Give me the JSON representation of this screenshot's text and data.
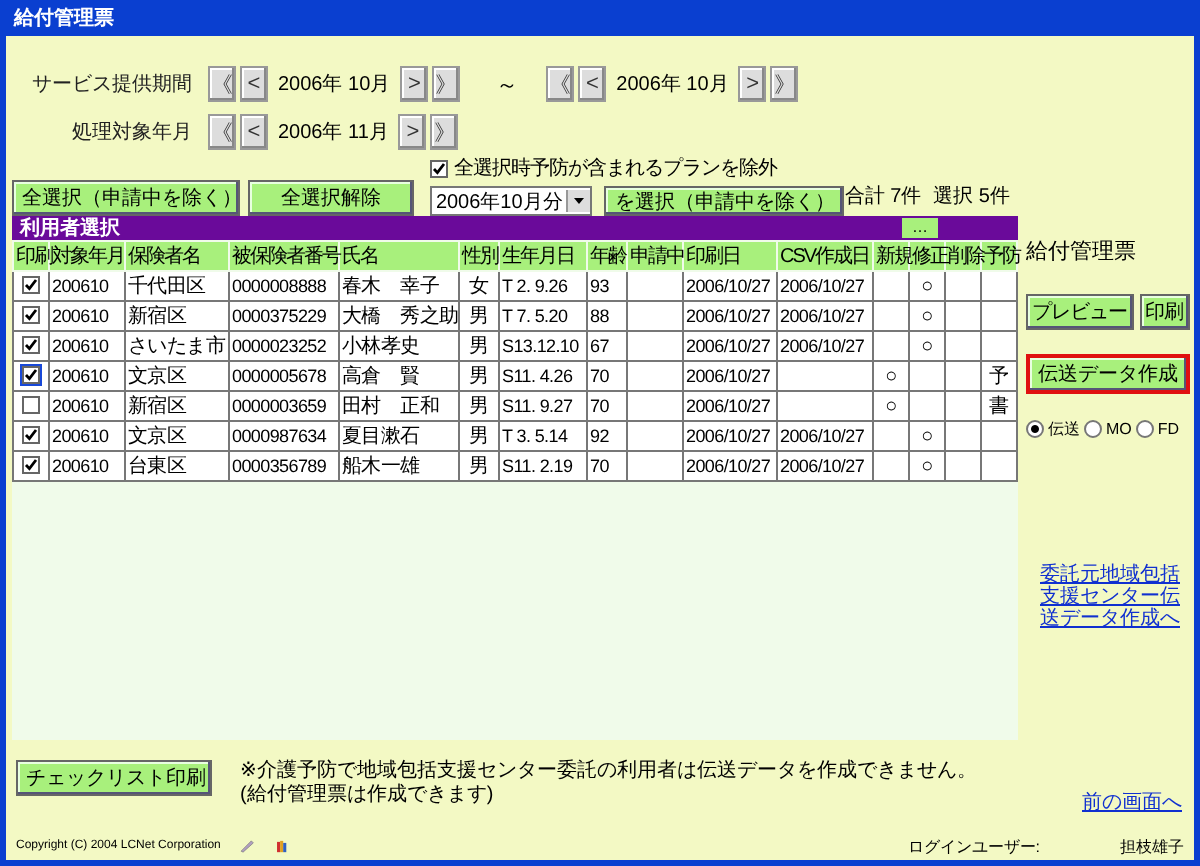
{
  "window": {
    "title": "給付管理票"
  },
  "service_period": {
    "label": "サービス提供期間",
    "from": {
      "prev_buttons": [
        "《",
        "<"
      ],
      "value": "2006年 10月",
      "next_buttons": [
        ">",
        "》"
      ]
    },
    "separator": "～",
    "to": {
      "prev_buttons": [
        "《",
        "<"
      ],
      "value": "2006年 10月",
      "next_buttons": [
        ">",
        "》"
      ]
    }
  },
  "processing_month": {
    "label": "処理対象年月",
    "prev_buttons": [
      "《",
      "<"
    ],
    "value": "2006年 11月",
    "next_buttons": [
      ">",
      "》"
    ]
  },
  "select_all_button": "全選択（申請中を除く）",
  "deselect_all_button": "全選択解除",
  "exclude_prevention": {
    "label": "全選択時予防が含まれるプランを除外",
    "checked": true
  },
  "month_select": {
    "value": "2006年10月分",
    "button": "を選択（申請中を除く）"
  },
  "totals": [
    "合計 7件",
    "選択 5件"
  ],
  "user_list": {
    "title": "利用者選択",
    "more_button": "…"
  },
  "table": {
    "columns": [
      "印刷",
      "対象年月",
      "保険者名",
      "被保険者番号",
      "氏名",
      "性別",
      "生年月日",
      "年齢",
      "申請中",
      "印刷日",
      "CSV作成日",
      "新規",
      "修正",
      "削除",
      "予防"
    ],
    "rows": [
      {
        "print": true,
        "focused": false,
        "cells": [
          "",
          "200610",
          "千代田区",
          "0000008888",
          "春木　幸子",
          "女",
          "T 2. 9.26",
          "93",
          "",
          "2006/10/27",
          "2006/10/27",
          "",
          "○",
          "",
          ""
        ]
      },
      {
        "print": true,
        "focused": false,
        "cells": [
          "",
          "200610",
          "新宿区",
          "0000375229",
          "大橋　秀之助",
          "男",
          "T 7. 5.20",
          "88",
          "",
          "2006/10/27",
          "2006/10/27",
          "",
          "○",
          "",
          ""
        ]
      },
      {
        "print": true,
        "focused": false,
        "cells": [
          "",
          "200610",
          "さいたま市",
          "0000023252",
          "小林孝史",
          "男",
          "S13.12.10",
          "67",
          "",
          "2006/10/27",
          "2006/10/27",
          "",
          "○",
          "",
          ""
        ]
      },
      {
        "print": true,
        "focused": true,
        "cells": [
          "",
          "200610",
          "文京区",
          "0000005678",
          "高倉　賢",
          "男",
          "S11. 4.26",
          "70",
          "",
          "2006/10/27",
          "",
          "○",
          "",
          "",
          "予"
        ]
      },
      {
        "print": false,
        "focused": false,
        "cells": [
          "",
          "200610",
          "新宿区",
          "0000003659",
          "田村　正和",
          "男",
          "S11. 9.27",
          "70",
          "",
          "2006/10/27",
          "",
          "○",
          "",
          "",
          "書"
        ]
      },
      {
        "print": true,
        "focused": false,
        "cells": [
          "",
          "200610",
          "文京区",
          "0000987634",
          "夏目漱石",
          "男",
          "T 3. 5.14",
          "92",
          "",
          "2006/10/27",
          "2006/10/27",
          "",
          "○",
          "",
          ""
        ]
      },
      {
        "print": true,
        "focused": false,
        "cells": [
          "",
          "200610",
          "台東区",
          "0000356789",
          "船木一雄",
          "男",
          "S11. 2.19",
          "70",
          "",
          "2006/10/27",
          "2006/10/27",
          "",
          "○",
          "",
          ""
        ]
      }
    ]
  },
  "side_panel": {
    "title": "給付管理票",
    "preview_button": "プレビュー",
    "print_button": "印刷",
    "transmit_button": {
      "label": "伝送データ作成",
      "highlighted": true
    },
    "media": [
      {
        "label": "伝送",
        "selected": true
      },
      {
        "label": "MO",
        "selected": false
      },
      {
        "label": "FD",
        "selected": false
      }
    ],
    "center_link": "委託元地域包括支援センター伝送データ作成へ"
  },
  "checklist_button": "チェックリスト印刷",
  "note": "※介護予防で地域包括支援センター委託の利用者は伝送データを作成できません。(給付管理票は作成できます)",
  "back_link": "前の画面へ",
  "footer": {
    "copyright": "Copyright (C) 2004 LCNet Corporation",
    "login_label": "ログインユーザー:",
    "user": "担枝雄子"
  }
}
